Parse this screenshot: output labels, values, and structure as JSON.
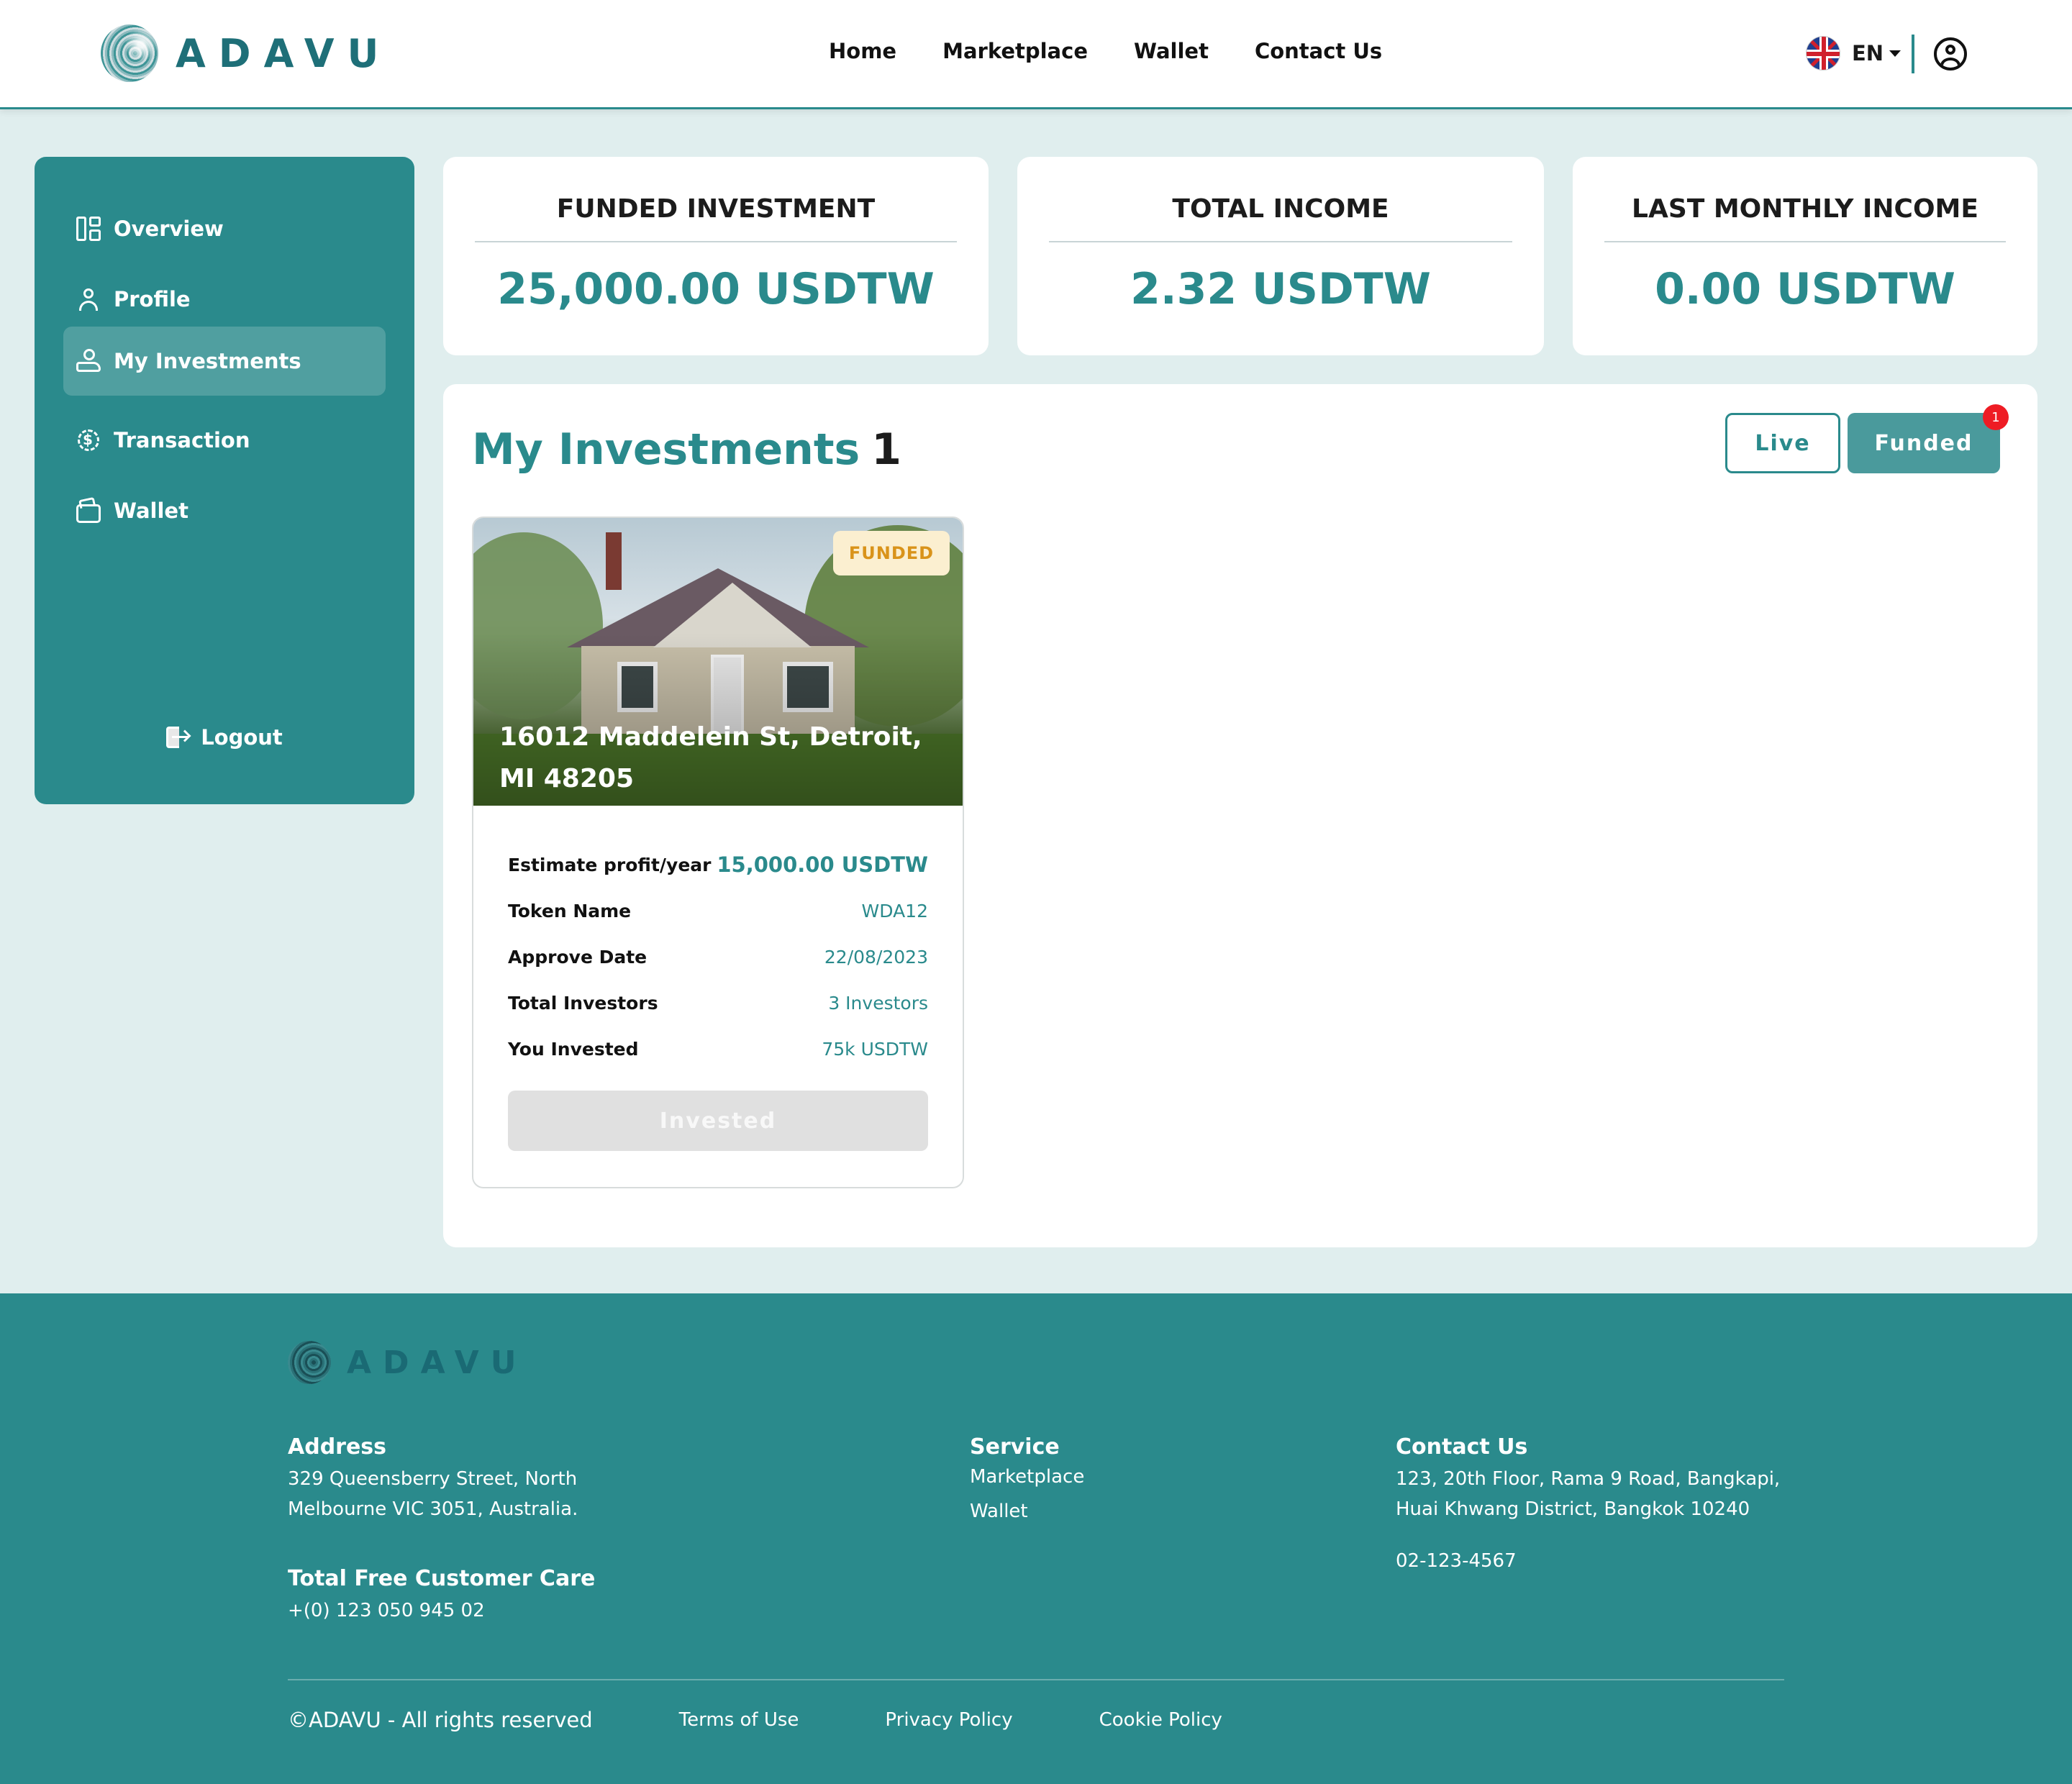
{
  "app": {
    "brand": "ADAVU"
  },
  "nav": {
    "home": "Home",
    "marketplace": "Marketplace",
    "wallet": "Wallet",
    "contact": "Contact Us"
  },
  "language": {
    "code": "EN"
  },
  "sidebar": {
    "items": [
      {
        "label": "Overview",
        "icon": "overview-icon"
      },
      {
        "label": "Profile",
        "icon": "user-icon"
      },
      {
        "label": "My Investments",
        "icon": "investment-icon",
        "active": true
      },
      {
        "label": "Transaction",
        "icon": "transaction-icon"
      },
      {
        "label": "Wallet",
        "icon": "wallet-icon"
      }
    ],
    "logout": "Logout"
  },
  "stats": [
    {
      "title": "FUNDED INVESTMENT",
      "value": "25,000.00 USDTW"
    },
    {
      "title": "TOTAL INCOME",
      "value": "2.32 USDTW"
    },
    {
      "title": "LAST MONTHLY INCOME",
      "value": "0.00 USDTW"
    }
  ],
  "investments": {
    "title": "My Investments",
    "count": "1",
    "tabs": {
      "live": "Live",
      "funded": "Funded",
      "funded_badge": "1"
    },
    "cards": [
      {
        "status": "FUNDED",
        "address": "16012 Maddelein St, Detroit, MI 48205",
        "details": [
          {
            "label": "Estimate profit/year",
            "value": "15,000.00 USDTW"
          },
          {
            "label": "Token Name",
            "value": "WDA12"
          },
          {
            "label": "Approve Date",
            "value": "22/08/2023"
          },
          {
            "label": "Total Investors",
            "value": "3 Investors"
          },
          {
            "label": "You Invested",
            "value": "75k USDTW"
          }
        ],
        "button": "Invested"
      }
    ]
  },
  "footer": {
    "brand": "ADAVU",
    "address": {
      "title": "Address",
      "line1": "329 Queensberry Street, North",
      "line2": "Melbourne VIC 3051, Australia."
    },
    "care": {
      "title": "Total Free Customer Care",
      "phone": "+(0) 123 050 945 02"
    },
    "service": {
      "title": "Service",
      "links": [
        "Marketplace",
        "Wallet"
      ]
    },
    "contact": {
      "title": "Contact Us",
      "line1": "123, 20th Floor, Rama 9 Road, Bangkapi,",
      "line2": "Huai Khwang District, Bangkok 10240",
      "phone": "02-123-4567"
    },
    "copyright": "©ADAVU - All rights reserved",
    "links": {
      "terms": "Terms of Use",
      "privacy": "Privacy Policy",
      "cookie": "Cookie Policy"
    }
  },
  "colors": {
    "primary": "#2a8a8c",
    "background": "#e0eeee",
    "funded_tag_bg": "#fbefd0",
    "funded_tag_text": "#d9931a",
    "badge": "#ee1c24"
  }
}
